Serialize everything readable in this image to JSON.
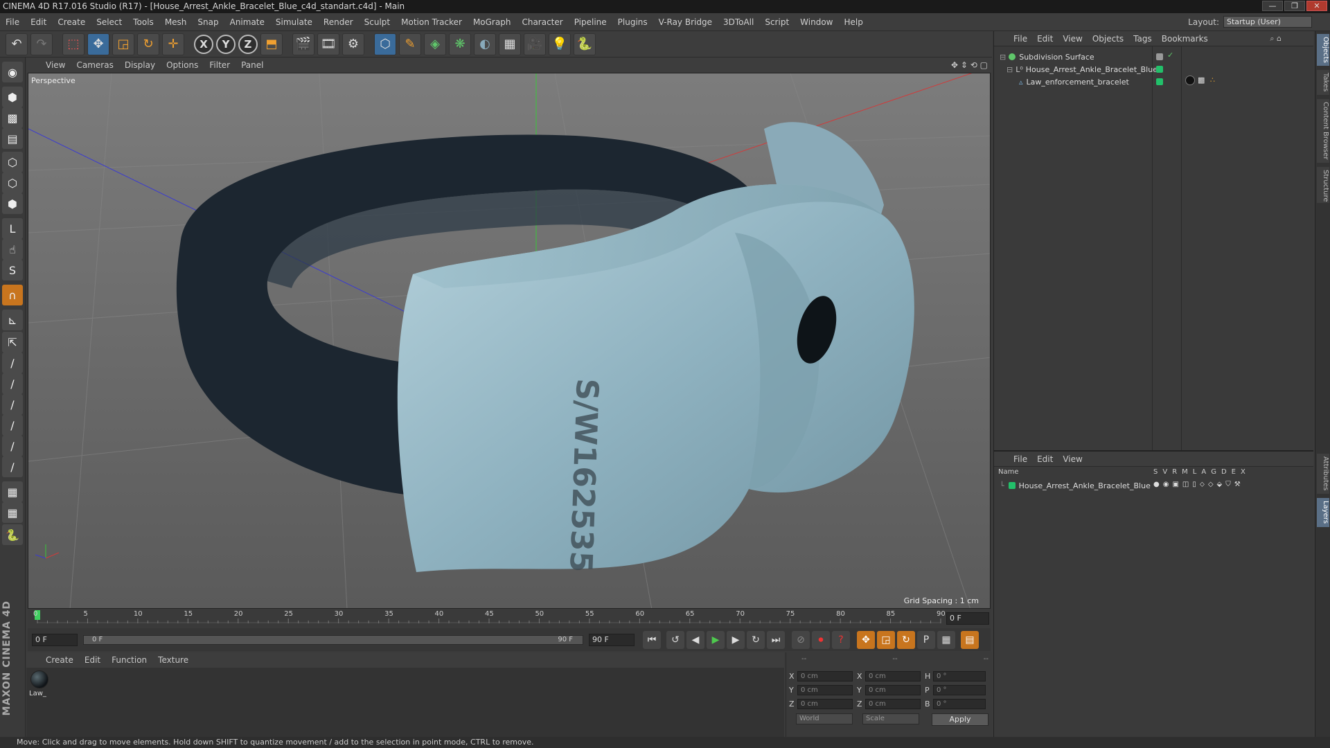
{
  "window": {
    "title": "CINEMA 4D R17.016 Studio (R17) - [House_Arrest_Ankle_Bracelet_Blue_c4d_standart.c4d] - Main",
    "buttons": [
      "—",
      "❐",
      "✕"
    ]
  },
  "menu": {
    "items": [
      "File",
      "Edit",
      "Create",
      "Select",
      "Tools",
      "Mesh",
      "Snap",
      "Animate",
      "Simulate",
      "Render",
      "Sculpt",
      "Motion Tracker",
      "MoGraph",
      "Character",
      "Pipeline",
      "Plugins",
      "V-Ray Bridge",
      "3DToAll",
      "Script",
      "Window",
      "Help"
    ],
    "layout_label": "Layout:",
    "layout_value": "Startup (User)"
  },
  "toolbar": {
    "axis_x": "X",
    "axis_y": "Y",
    "axis_z": "Z"
  },
  "viewport": {
    "menu": [
      "View",
      "Cameras",
      "Display",
      "Options",
      "Filter",
      "Panel"
    ],
    "label": "Perspective",
    "grid_spacing": "Grid Spacing : 1 cm",
    "engraving": "S/W162535"
  },
  "timeline": {
    "ticks": [
      "0",
      "5",
      "10",
      "15",
      "20",
      "25",
      "30",
      "35",
      "40",
      "45",
      "50",
      "55",
      "60",
      "65",
      "70",
      "75",
      "80",
      "85",
      "90"
    ],
    "current_frame": "0 F"
  },
  "transport": {
    "start": "0 F",
    "range_start": "0 F",
    "range_end": "90 F",
    "end": "90 F"
  },
  "material_manager": {
    "menu": [
      "Create",
      "Edit",
      "Function",
      "Texture"
    ],
    "material_name": "Law_"
  },
  "coordinates": {
    "headers": [
      "--",
      "--",
      "--"
    ],
    "rows": [
      {
        "a": "X",
        "av": "0 cm",
        "b": "X",
        "bv": "0 cm",
        "c": "H",
        "cv": "0 °"
      },
      {
        "a": "Y",
        "av": "0 cm",
        "b": "Y",
        "bv": "0 cm",
        "c": "P",
        "cv": "0 °"
      },
      {
        "a": "Z",
        "av": "0 cm",
        "b": "Z",
        "bv": "0 cm",
        "c": "B",
        "cv": "0 °"
      }
    ],
    "space": "World",
    "mode": "Scale",
    "apply": "Apply"
  },
  "object_manager": {
    "menu": [
      "File",
      "Edit",
      "View",
      "Objects",
      "Tags",
      "Bookmarks"
    ],
    "objects": [
      {
        "name": "Subdivision Surface",
        "color": "#5fc76a"
      },
      {
        "name": "House_Arrest_Ankle_Bracelet_Blue",
        "color": "#22c06a"
      },
      {
        "name": "Law_enforcement_bracelet",
        "color": "#22c06a"
      }
    ]
  },
  "layer_manager": {
    "menu": [
      "File",
      "Edit",
      "View"
    ],
    "name_header": "Name",
    "columns": [
      "S",
      "V",
      "R",
      "M",
      "L",
      "A",
      "G",
      "D",
      "E",
      "X"
    ],
    "layer_name": "House_Arrest_Ankle_Bracelet_Blue",
    "layer_color": "#22c06a"
  },
  "right_tabs": [
    "Objects",
    "Takes",
    "Content Browser",
    "Structure",
    "Attributes",
    "Layers"
  ],
  "status": "Move: Click and drag to move elements. Hold down SHIFT to quantize movement / add to the selection in point mode, CTRL to remove.",
  "brand": "MAXON CINEMA 4D"
}
